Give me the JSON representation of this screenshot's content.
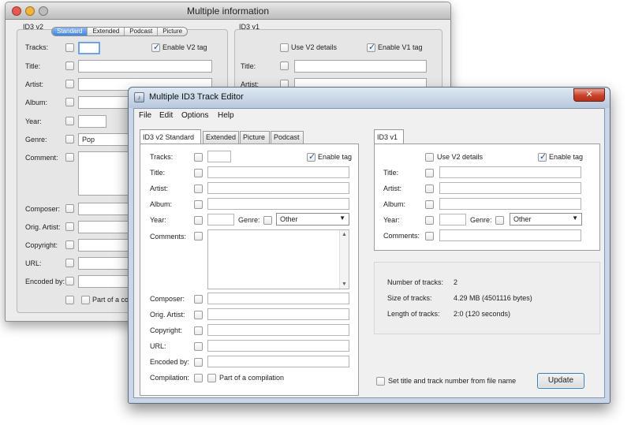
{
  "mac": {
    "title": "Multiple information",
    "v2_group_label": "ID3 v2",
    "v1_group_label": "ID3 v1",
    "tabs": [
      "Standard",
      "Extended",
      "Podcast",
      "Picture"
    ],
    "labels": {
      "tracks": "Tracks:",
      "title": "Title:",
      "artist": "Artist:",
      "album": "Album:",
      "year": "Year:",
      "genre": "Genre:",
      "comment": "Comment:",
      "composer": "Composer:",
      "orig_artist": "Orig. Artist:",
      "copyright": "Copyright:",
      "url": "URL:",
      "encoded_by": "Encoded by:",
      "part_of_compilation": "Part of a co"
    },
    "genre_value": "Pop",
    "enable_v2_tag": "Enable V2 tag",
    "use_v2_details": "Use V2 details",
    "enable_v1_tag": "Enable V1 tag",
    "v1_labels": {
      "title": "Title:",
      "artist": "Artist:"
    }
  },
  "win": {
    "title": "Multiple ID3 Track Editor",
    "close_glyph": "✕",
    "app_icon_glyph": "♪",
    "menu": [
      "File",
      "Edit",
      "Options",
      "Help"
    ],
    "tabs": [
      "ID3 v2 Standard",
      "Extended",
      "Picture",
      "Podcast"
    ],
    "v1_tab": "ID3 v1",
    "labels": {
      "tracks": "Tracks:",
      "title": "Title:",
      "artist": "Artist:",
      "album": "Album:",
      "year": "Year:",
      "genre": "Genre:",
      "comments": "Comments:",
      "composer": "Composer:",
      "orig_artist": "Orig. Artist:",
      "copyright": "Copyright:",
      "url": "URL:",
      "encoded_by": "Encoded by:",
      "compilation": "Compilation:"
    },
    "enable_tag": "Enable tag",
    "genre_value": "Other",
    "part_of_compilation": "Part of a compilation",
    "v1": {
      "use_v2_details": "Use V2 details",
      "enable_tag": "Enable tag",
      "labels": {
        "title": "Title:",
        "artist": "Artist:",
        "album": "Album:",
        "year": "Year:",
        "genre": "Genre:",
        "comments": "Comments:"
      },
      "genre_value": "Other"
    },
    "info": {
      "num_tracks_label": "Number of tracks:",
      "num_tracks_value": "2",
      "size_label": "Size of tracks:",
      "size_value": "4.29 MB (4501116 bytes)",
      "length_label": "Length of tracks:",
      "length_value": "2:0 (120 seconds)"
    },
    "set_title_from_filename": "Set title and track number from file name",
    "update_button": "Update"
  },
  "icons": {
    "dropdown_arrow": "▼",
    "scroll_up": "▲",
    "scroll_down": "▼"
  }
}
